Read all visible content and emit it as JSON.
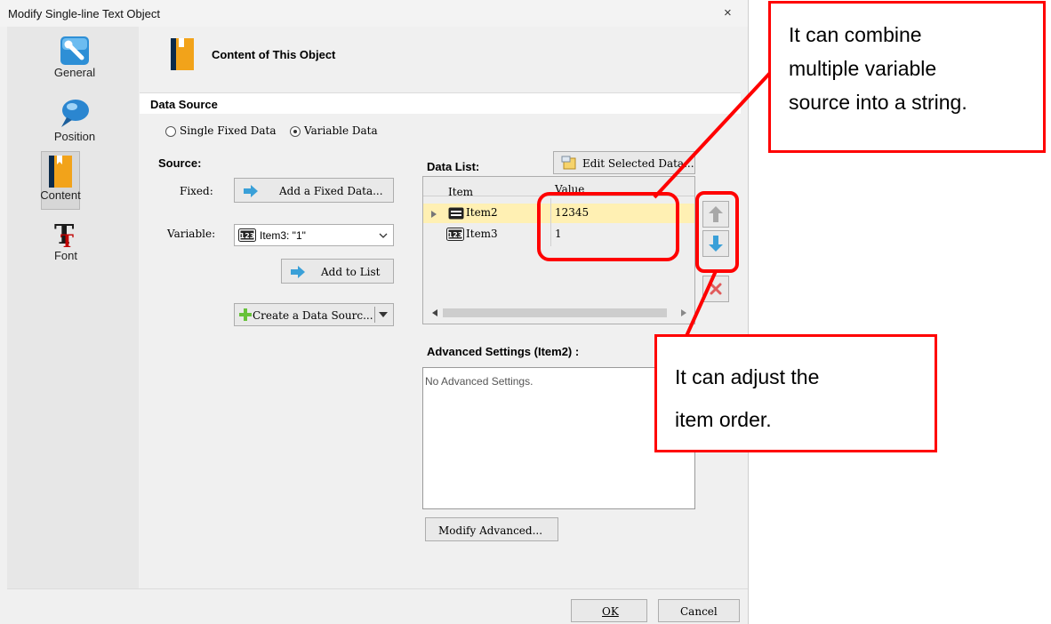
{
  "window": {
    "title": "Modify Single-line Text Object",
    "close": "×"
  },
  "sidebar": {
    "items": [
      {
        "label": "General",
        "icon": "general-icon"
      },
      {
        "label": "Position",
        "icon": "position-pin-icon"
      },
      {
        "label": "Content",
        "icon": "content-book-icon",
        "selected": true
      },
      {
        "label": "Font",
        "icon": "font-icon"
      }
    ]
  },
  "header": {
    "title": "Content of This Object"
  },
  "data_source": {
    "section_title": "Data Source",
    "radio_fixed": "Single Fixed Data",
    "radio_variable": "Variable Data",
    "selected": "Variable Data"
  },
  "source": {
    "label": "Source:",
    "fixed_label": "Fixed:",
    "add_fixed_button": "Add a Fixed Data...",
    "variable_label": "Variable:",
    "variable_value": "Item3: \"1\"",
    "add_to_list_button": "Add to List",
    "create_source_button": "Create a Data Sourc..."
  },
  "data_list": {
    "label": "Data List:",
    "edit_button": "Edit Selected Data...",
    "columns": [
      "Item",
      "Value"
    ],
    "rows": [
      {
        "item": "Item2",
        "value": "12345",
        "selected": true
      },
      {
        "item": "Item3",
        "value": "1",
        "selected": false
      }
    ]
  },
  "advanced": {
    "label": "Advanced Settings (Item2) :",
    "text": "No Advanced Settings.",
    "modify_button": "Modify Advanced..."
  },
  "footer": {
    "ok": "OK",
    "cancel": "Cancel"
  },
  "callouts": {
    "top": [
      "It can combine",
      "multiple variable",
      "source into a string."
    ],
    "bottom": [
      "It can adjust the",
      "item order."
    ]
  },
  "colors": {
    "annotation_red": "#ff0000",
    "selected_row": "#fff0b3",
    "accent_blue": "#3aa0d8"
  }
}
